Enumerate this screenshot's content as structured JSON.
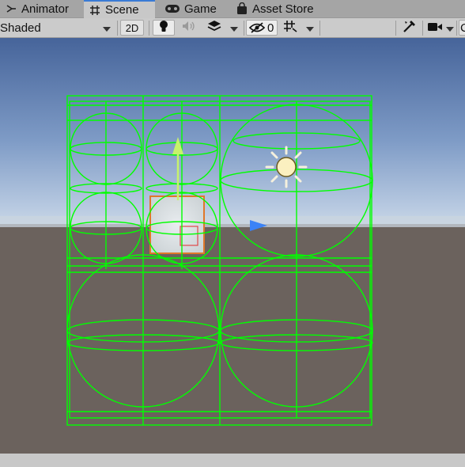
{
  "tabs": [
    {
      "label": "Animator",
      "icon": "animator-icon"
    },
    {
      "label": "Scene",
      "icon": "scene-grid-icon",
      "active": true
    },
    {
      "label": "Game",
      "icon": "gamepad-icon"
    },
    {
      "label": "Asset Store",
      "icon": "shopping-bag-icon"
    }
  ],
  "toolbar": {
    "draw_mode": "Shaded",
    "mode_2d": "2D",
    "hidden_count": "0",
    "camera_label": "C"
  },
  "colors": {
    "gizmo_green": "#00ff00",
    "sky_top": "#46649a",
    "horizon": "#c8d6e6",
    "ground": "#6b625d",
    "arrow_yellow": "#c6f26b",
    "arrow_blue": "#3b82f6"
  },
  "icons": [
    "light-bulb-icon",
    "audio-speaker-icon",
    "effects-layers-icon",
    "hidden-eye-icon",
    "gizmo-grid-icon",
    "tools-icon",
    "camera-icon",
    "sun-light-icon"
  ]
}
